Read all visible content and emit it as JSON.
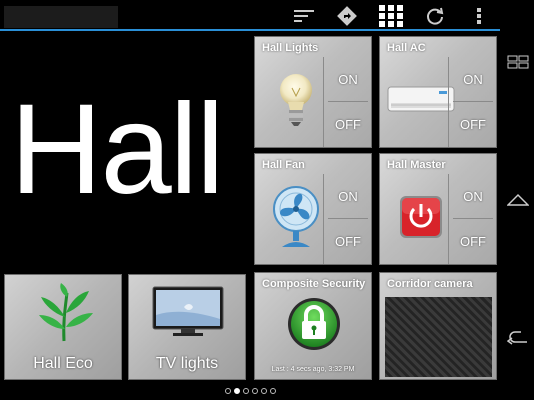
{
  "room": {
    "name": "Hall"
  },
  "toolbar": {
    "icons": [
      "sort-icon",
      "directions-icon",
      "grid-icon",
      "refresh-icon",
      "overflow-menu-icon"
    ]
  },
  "tiles": {
    "hall_lights": {
      "title": "Hall Lights",
      "on_label": "ON",
      "off_label": "OFF"
    },
    "hall_ac": {
      "title": "Hall AC",
      "on_label": "ON",
      "off_label": "OFF"
    },
    "hall_fan": {
      "title": "Hall Fan",
      "on_label": "ON",
      "off_label": "OFF"
    },
    "hall_master": {
      "title": "Hall Master",
      "on_label": "ON",
      "off_label": "OFF"
    },
    "composite_security": {
      "title": "Composite Security",
      "status": "Last : 4 secs ago, 3:32 PM"
    },
    "corridor_camera": {
      "title": "Corridor camera"
    },
    "hall_eco": {
      "label": "Hall Eco"
    },
    "tv_lights": {
      "label": "TV lights"
    }
  },
  "pager": {
    "count": 6,
    "active_index": 1
  },
  "colors": {
    "accent": "#2a8fd6",
    "master_red": "#d8232a",
    "security_green": "#2fa32f"
  }
}
